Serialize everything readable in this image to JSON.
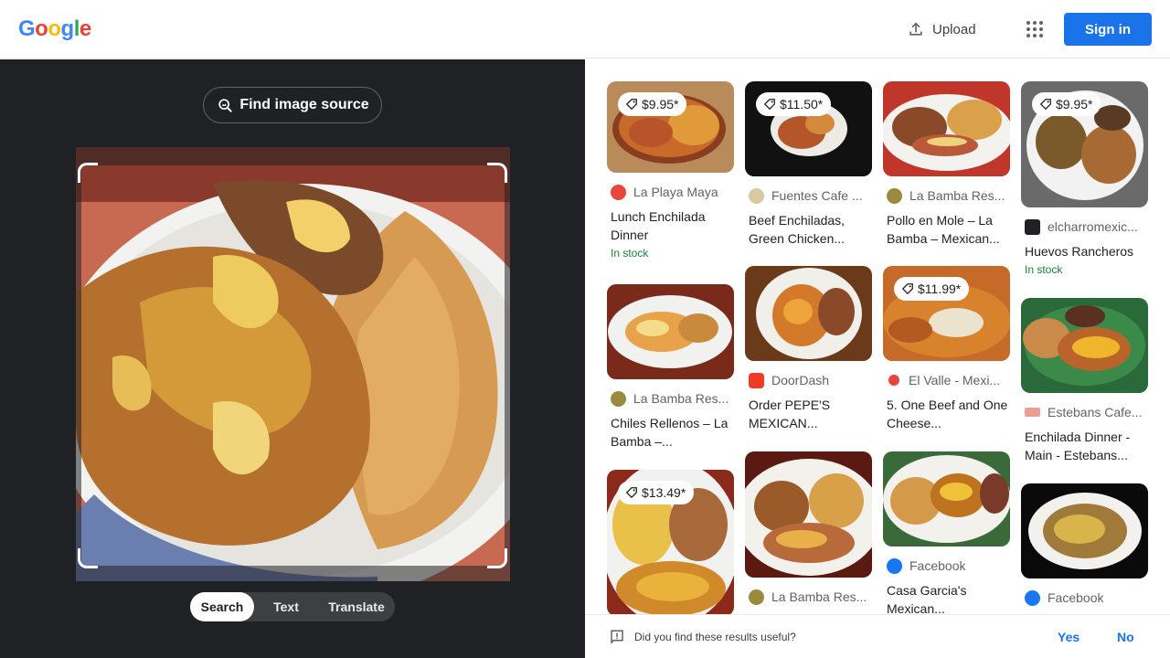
{
  "header": {
    "logo_letters": [
      "G",
      "o",
      "o",
      "g",
      "l",
      "e"
    ],
    "logo_colors": [
      "#4285F4",
      "#EA4335",
      "#FBBC05",
      "#4285F4",
      "#34A853",
      "#EA4335"
    ],
    "upload_label": "Upload",
    "signin_label": "Sign in"
  },
  "lens": {
    "find_source_label": "Find image source",
    "modes": [
      "Search",
      "Text",
      "Translate"
    ],
    "active_mode": "Search"
  },
  "results": [
    {
      "price": "$9.95*",
      "source": "La Playa Maya",
      "title": "Lunch Enchilada Dinner",
      "stock": "In stock"
    },
    {
      "price": "$11.50*",
      "source": "Fuentes Cafe ...",
      "title": "Beef Enchiladas, Green Chicken...",
      "stock": ""
    },
    {
      "price": "",
      "source": "La Bamba Res...",
      "title": "Pollo en Mole – La Bamba – Mexican...",
      "stock": ""
    },
    {
      "price": "$9.95*",
      "source": "elcharromexic...",
      "title": "Huevos Rancheros",
      "stock": "In stock"
    },
    {
      "price": "",
      "source": "La Bamba Res...",
      "title": "Chiles Rellenos – La Bamba –...",
      "stock": ""
    },
    {
      "price": "",
      "source": "DoorDash",
      "title": "Order PEPE'S MEXICAN...",
      "stock": ""
    },
    {
      "price": "$11.99*",
      "source": "El Valle - Mexi...",
      "title": "5. One Beef and One Cheese...",
      "stock": ""
    },
    {
      "price": "",
      "source": "Estebans Cafe...",
      "title": "Enchilada Dinner - Main - Estebans...",
      "stock": ""
    },
    {
      "price": "$13.49*",
      "source": "",
      "title": "",
      "stock": ""
    },
    {
      "price": "",
      "source": "La Bamba Res...",
      "title": "",
      "stock": ""
    },
    {
      "price": "",
      "source": "Facebook",
      "title": "Casa Garcia's Mexican...",
      "stock": ""
    },
    {
      "price": "",
      "source": "Facebook",
      "title": "",
      "stock": ""
    }
  ],
  "feedback": {
    "question": "Did you find these results useful?",
    "yes_label": "Yes",
    "no_label": "No"
  }
}
